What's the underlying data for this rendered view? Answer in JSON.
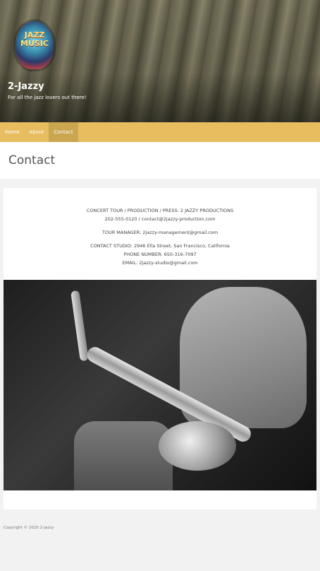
{
  "header": {
    "logo_text_line1": "JAZZ",
    "logo_text_line2": "MUSIC",
    "site_title": "2-Jazzy",
    "tagline": "For all the jazz lovers out there!"
  },
  "nav": {
    "items": [
      {
        "label": "Home"
      },
      {
        "label": "About"
      },
      {
        "label": "Contact"
      }
    ]
  },
  "page": {
    "title": "Contact"
  },
  "contact": {
    "line1": "CONCERT TOUR / PRODUCTION / PRESS: 2 JAZZY PRODUCTIONS",
    "line2": "202-555-0120 / contact@2jazzy-production.com",
    "line3": "TOUR MANAGER: 2jazzy-management@gmail.com",
    "line4": "CONTACT STUDIO: 2946 Ella Street, San Francisco, California",
    "line5": "PHONE NUMBER: 650-316-7097",
    "line6": "EMAIL: 2jazzy-studio@gmail.com"
  },
  "footer": {
    "copyright": "Copyright © 2020 2-Jazzy"
  },
  "colors": {
    "nav_bg": "#e7bd5f",
    "nav_active": "#caa651"
  }
}
